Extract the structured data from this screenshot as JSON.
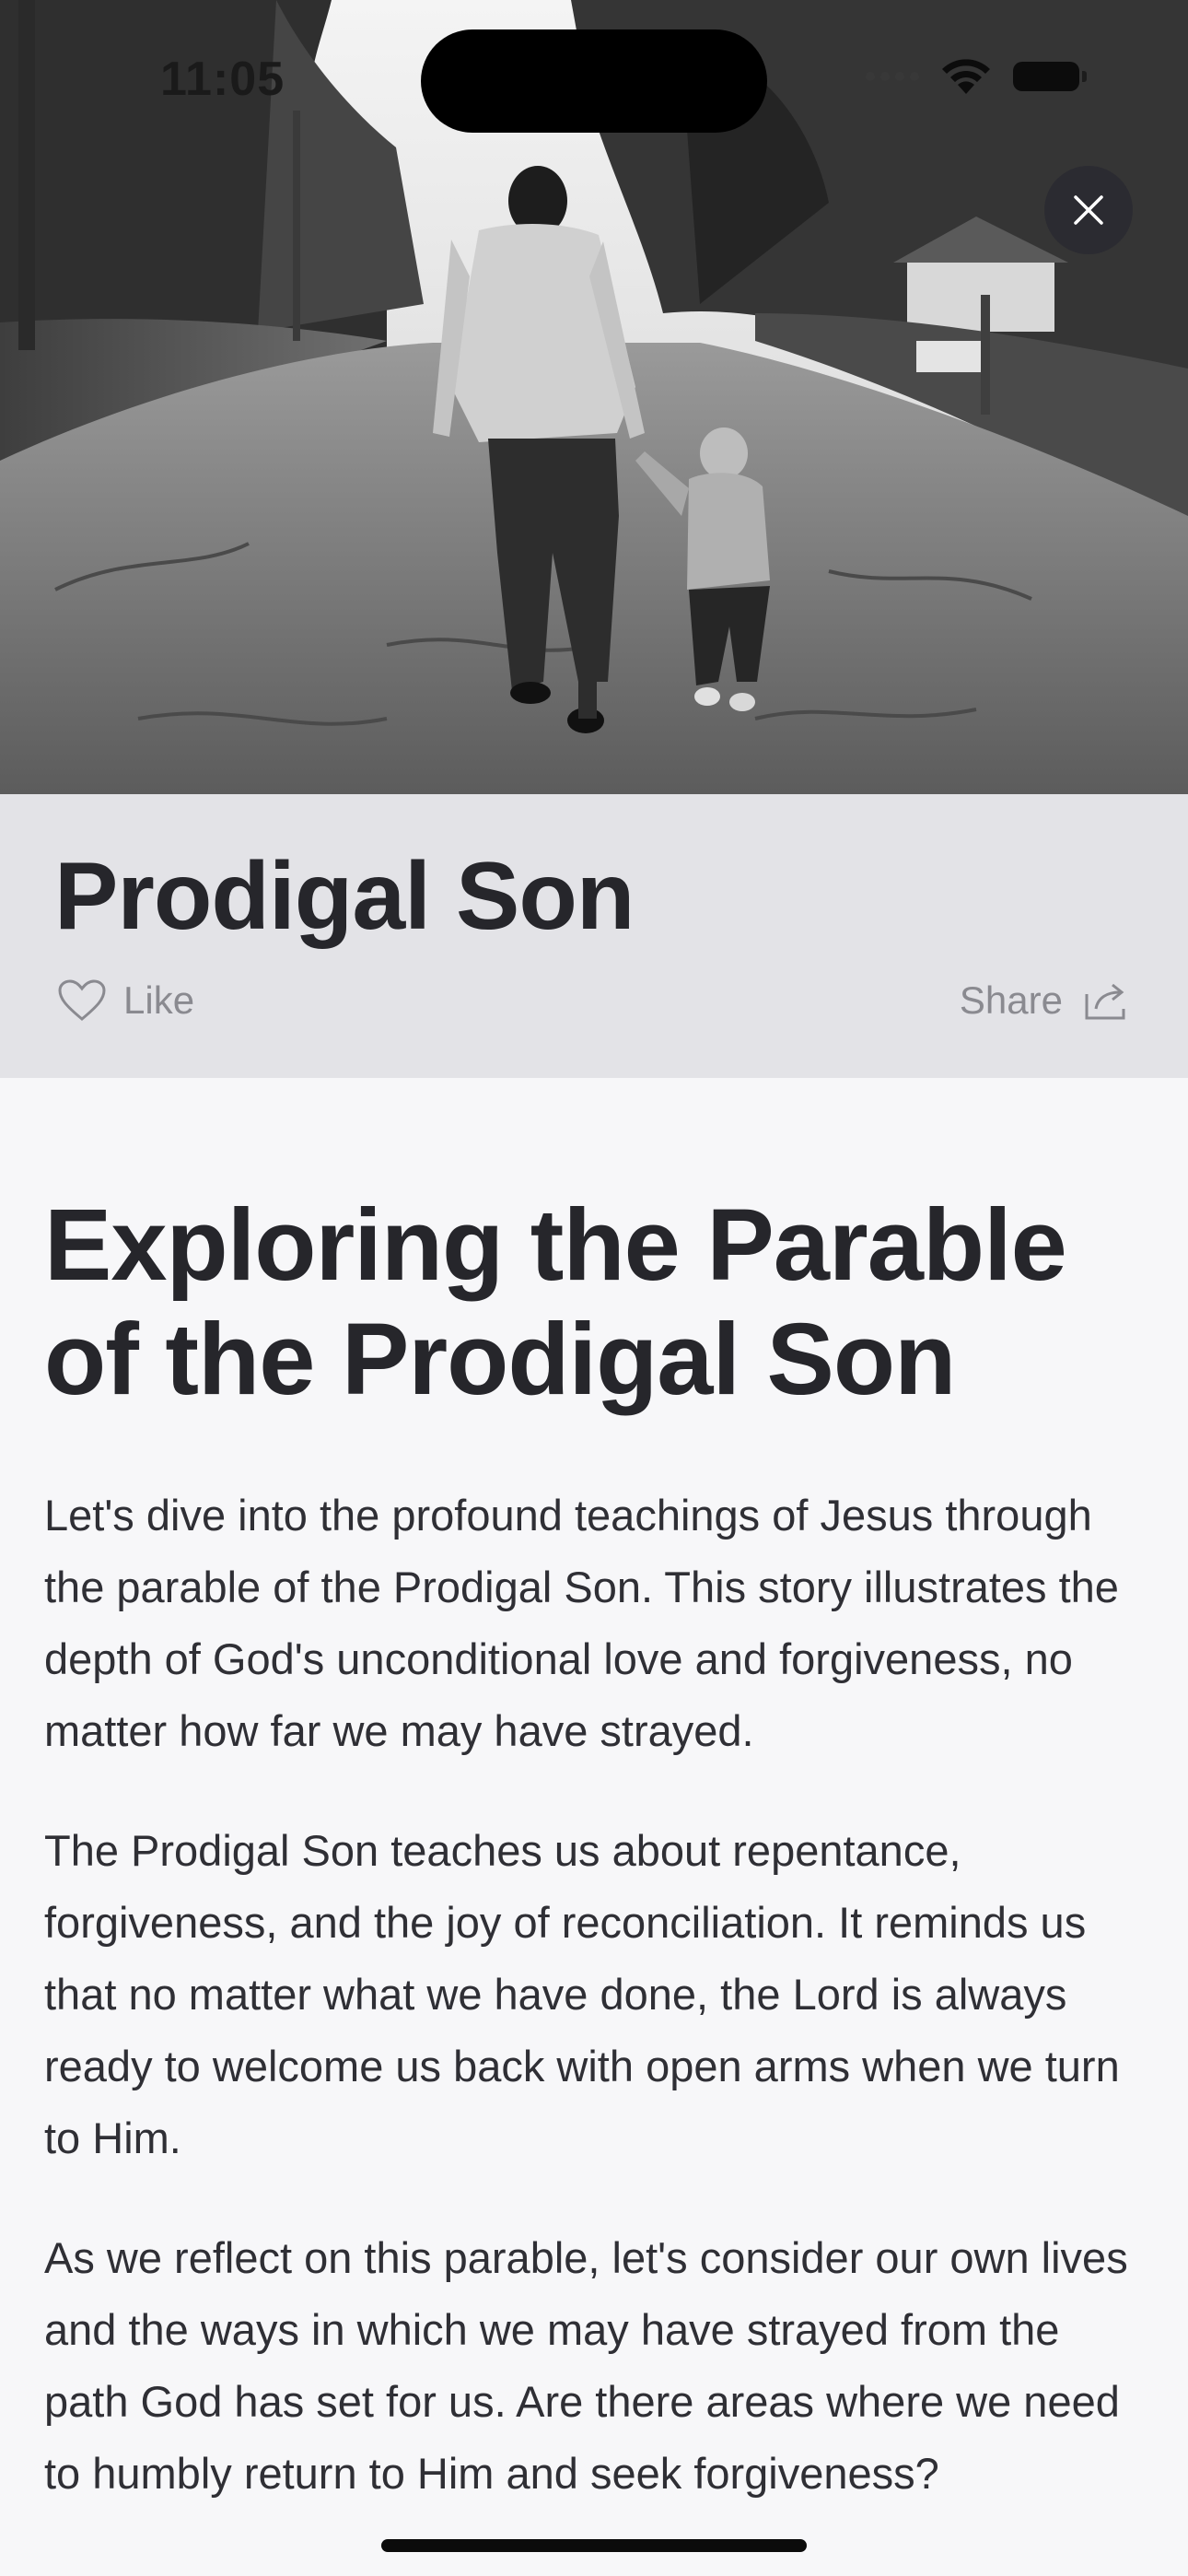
{
  "status_bar": {
    "time": "11:05"
  },
  "hero": {
    "image_description_icon": "father-and-son-walking-photo"
  },
  "post": {
    "title": "Prodigal Son",
    "like_label": "Like",
    "share_label": "Share"
  },
  "article": {
    "heading": "Exploring the Parable of the Prodigal Son",
    "paragraphs": [
      "Let's dive into the profound teachings of Jesus through the parable of the Prodigal Son. This story illustrates the depth of God's unconditional love and forgiveness, no matter how far we may have strayed.",
      "The Prodigal Son teaches us about repentance, forgiveness, and the joy of reconciliation. It reminds us that no matter what we have done, the Lord is always ready to welcome us back with open arms when we turn to Him.",
      "As we reflect on this parable, let's consider our own lives and the ways in which we may have strayed from the path God has set for us. Are there areas where we need to humbly return to Him and seek forgiveness?"
    ]
  },
  "colors": {
    "title_band": "#e3e3e7",
    "background": "#f7f7f9",
    "text": "#26262b",
    "muted": "#8a8a90"
  }
}
